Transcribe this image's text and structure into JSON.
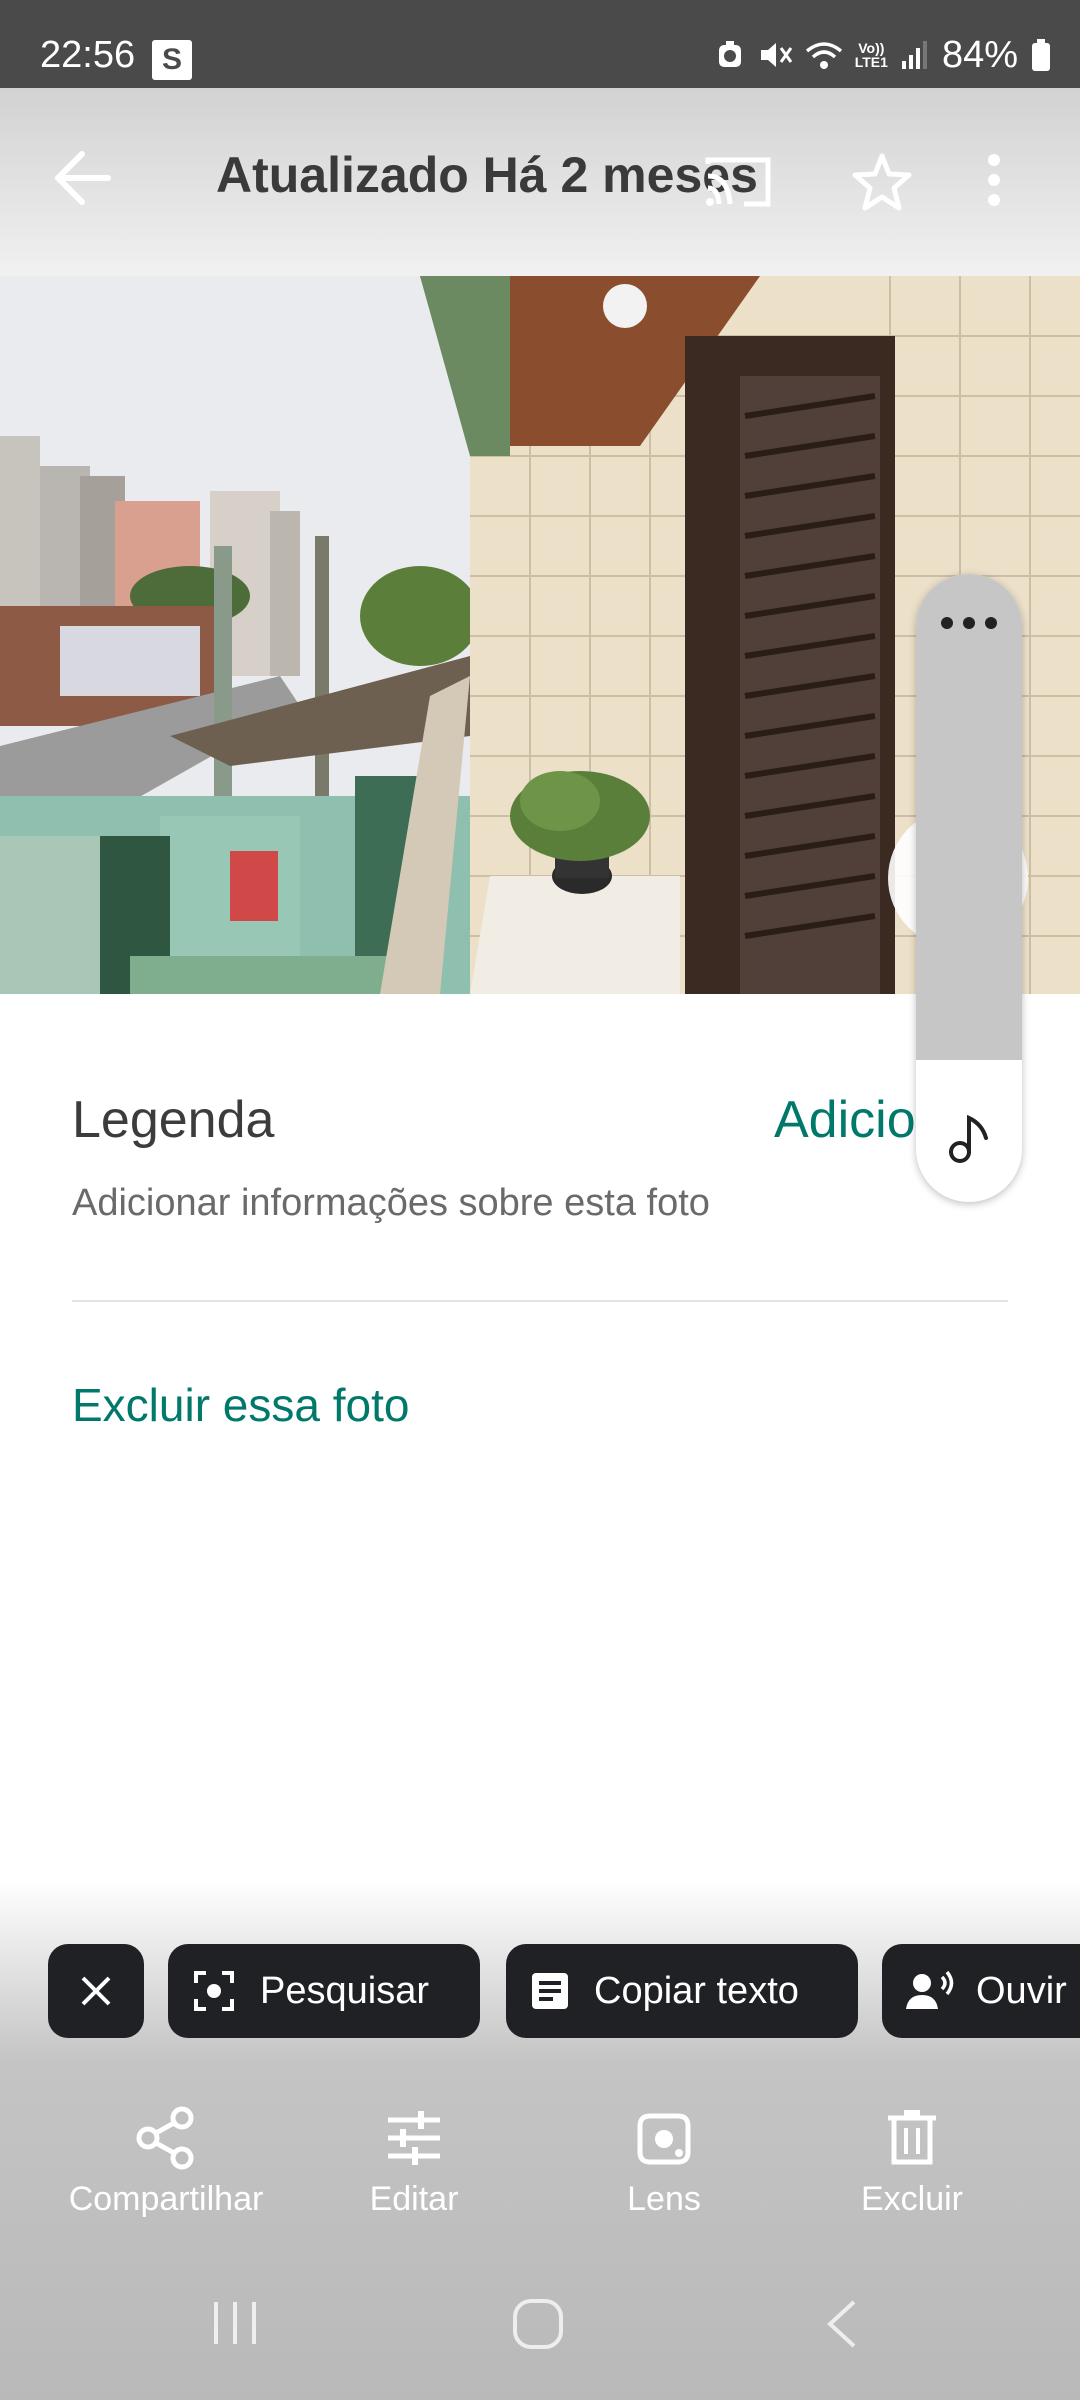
{
  "status_bar": {
    "time": "22:56",
    "s_badge": "S",
    "network": "LTE1",
    "battery": "84%"
  },
  "header": {
    "title": "Atualizado Há 2 meses"
  },
  "caption": {
    "label": "Legenda",
    "add_action": "Adicio",
    "placeholder": "Adicionar informações sobre esta foto"
  },
  "delete_link": "Excluir essa foto",
  "chips": {
    "search": "Pesquisar",
    "copy_text": "Copiar texto",
    "listen": "Ouvir"
  },
  "actions": {
    "share": "Compartilhar",
    "edit": "Editar",
    "lens": "Lens",
    "delete": "Excluir"
  },
  "colors": {
    "accent": "#00796b",
    "chip_bg": "#202124",
    "status_bar": "#4a4a4a"
  }
}
